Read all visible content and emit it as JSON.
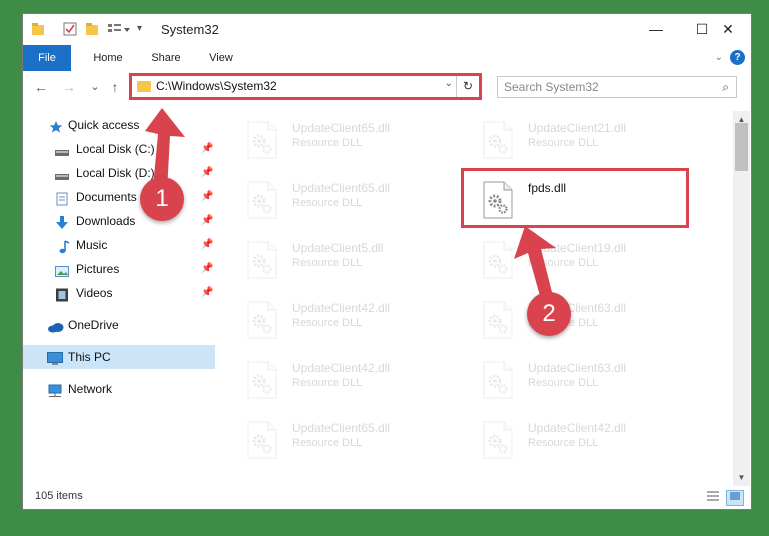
{
  "window": {
    "title": "System32",
    "controls": {
      "minimize": "—",
      "maximize": "☐",
      "close": "✕"
    }
  },
  "ribbon": {
    "tabs": [
      "File",
      "Home",
      "Share",
      "View"
    ],
    "help": "?",
    "expand": "⌄"
  },
  "navbar": {
    "back": "←",
    "forward": "→",
    "recent": "⌄",
    "up": "↑",
    "address": "C:\\Windows\\System32",
    "address_dropdown": "⌄",
    "refresh": "↻",
    "search_placeholder": "Search System32",
    "search_icon": "⌕"
  },
  "sidebar": {
    "items": [
      {
        "label": "Quick access",
        "icon": "star-icon"
      },
      {
        "label": "Local Disk (C:)",
        "icon": "drive-icon",
        "pinned": true
      },
      {
        "label": "Local Disk (D:)",
        "icon": "drive-icon",
        "pinned": true
      },
      {
        "label": "Documents",
        "icon": "documents-icon",
        "pinned": true
      },
      {
        "label": "Downloads",
        "icon": "downloads-icon",
        "pinned": true
      },
      {
        "label": "Music",
        "icon": "music-icon",
        "pinned": true
      },
      {
        "label": "Pictures",
        "icon": "pictures-icon",
        "pinned": true
      },
      {
        "label": "Videos",
        "icon": "videos-icon",
        "pinned": true
      },
      {
        "label": "OneDrive",
        "icon": "cloud-icon"
      },
      {
        "label": "This PC",
        "icon": "computer-icon",
        "selected": true
      },
      {
        "label": "Network",
        "icon": "network-icon"
      }
    ],
    "pin_glyph": "📌"
  },
  "files": [
    {
      "name": "UpdateClient65.dll",
      "type": "Resource DLL"
    },
    {
      "name": "UpdateClient21.dll",
      "type": "Resource DLL"
    },
    {
      "name": "UpdateClient65.dll",
      "type": "Resource DLL"
    },
    {
      "name": "fpds.dll",
      "type": "",
      "highlight": true
    },
    {
      "name": "UpdateClient5.dll",
      "type": "Resource DLL"
    },
    {
      "name": "UpdateClient19.dll",
      "type": "Resource DLL"
    },
    {
      "name": "UpdateClient42.dll",
      "type": "Resource DLL"
    },
    {
      "name": "UpdateClient63.dll",
      "type": "Resource DLL"
    },
    {
      "name": "UpdateClient42.dll",
      "type": "Resource DLL"
    },
    {
      "name": "UpdateClient63.dll",
      "type": "Resource DLL"
    },
    {
      "name": "UpdateClient65.dll",
      "type": "Resource DLL"
    },
    {
      "name": "UpdateClient42.dll",
      "type": "Resource DLL"
    }
  ],
  "status": {
    "item_count": "105 items"
  },
  "annotations": [
    {
      "number": "1"
    },
    {
      "number": "2"
    }
  ],
  "colors": {
    "accent": "#1a6fc7",
    "highlight": "#d9434e",
    "selection": "#cce4f7",
    "background": "#3f8c46"
  }
}
